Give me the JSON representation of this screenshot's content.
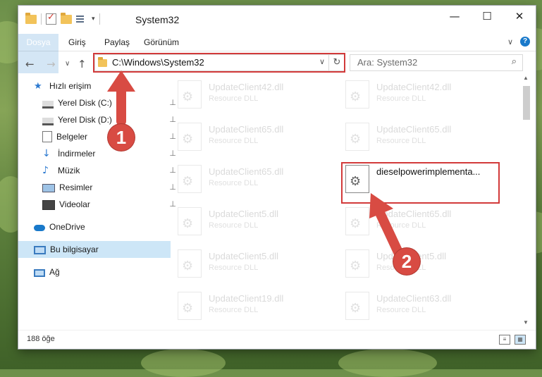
{
  "window": {
    "title": "System32",
    "controls": {
      "minimize": "—",
      "maximize": "☐",
      "close": "✕"
    }
  },
  "ribbon": {
    "tabs": [
      "Dosya",
      "Giriş",
      "Paylaş",
      "Görünüm"
    ],
    "collapse_icon": "∨",
    "help": "?"
  },
  "nav": {
    "back": "←",
    "forward": "→",
    "recent": "∨",
    "up": "↑",
    "address": "C:\\Windows\\System32",
    "address_dropdown": "∨",
    "refresh": "↻",
    "search_placeholder": "Ara: System32",
    "search_icon": "⌕"
  },
  "sidebar": {
    "items": [
      {
        "label": "Hızlı erişim",
        "icon": "star-icon",
        "pinned": false
      },
      {
        "label": "Yerel Disk (C:)",
        "icon": "drive-icon",
        "pinned": true
      },
      {
        "label": "Yerel Disk (D:)",
        "icon": "drive-icon",
        "pinned": true
      },
      {
        "label": "Belgeler",
        "icon": "documents-icon",
        "pinned": true
      },
      {
        "label": "İndirmeler",
        "icon": "download-icon",
        "pinned": true
      },
      {
        "label": "Müzik",
        "icon": "music-icon",
        "pinned": true
      },
      {
        "label": "Resimler",
        "icon": "pictures-icon",
        "pinned": true
      },
      {
        "label": "Videolar",
        "icon": "videos-icon",
        "pinned": true
      },
      {
        "label": "OneDrive",
        "icon": "cloud-icon",
        "pinned": false
      },
      {
        "label": "Bu bilgisayar",
        "icon": "computer-icon",
        "pinned": false
      },
      {
        "label": "Ağ",
        "icon": "network-icon",
        "pinned": false
      }
    ],
    "pin_glyph": "📌"
  },
  "files": [
    {
      "name": "UpdateClient42.dll",
      "type": "Resource DLL"
    },
    {
      "name": "UpdateClient42.dll",
      "type": "Resource DLL"
    },
    {
      "name": "UpdateClient65.dll",
      "type": "Resource DLL"
    },
    {
      "name": "UpdateClient65.dll",
      "type": "Resource DLL"
    },
    {
      "name": "UpdateClient65.dll",
      "type": "Resource DLL"
    },
    {
      "name": "dieselpowerimplementa...",
      "type": ""
    },
    {
      "name": "UpdateClient5.dll",
      "type": "Resource DLL"
    },
    {
      "name": "UpdateClient65.dll",
      "type": "Resource DLL"
    },
    {
      "name": "UpdateClient5.dll",
      "type": "Resource DLL"
    },
    {
      "name": "UpdateClient5.dll",
      "type": "Resource DLL"
    },
    {
      "name": "UpdateClient19.dll",
      "type": "Resource DLL"
    },
    {
      "name": "UpdateClient63.dll",
      "type": "Resource DLL"
    }
  ],
  "status": {
    "count": "188 öğe"
  },
  "callouts": {
    "one": "1",
    "two": "2"
  },
  "colors": {
    "accent": "#1979ca",
    "highlight": "#d23a3a",
    "selection": "#cde6f7"
  }
}
